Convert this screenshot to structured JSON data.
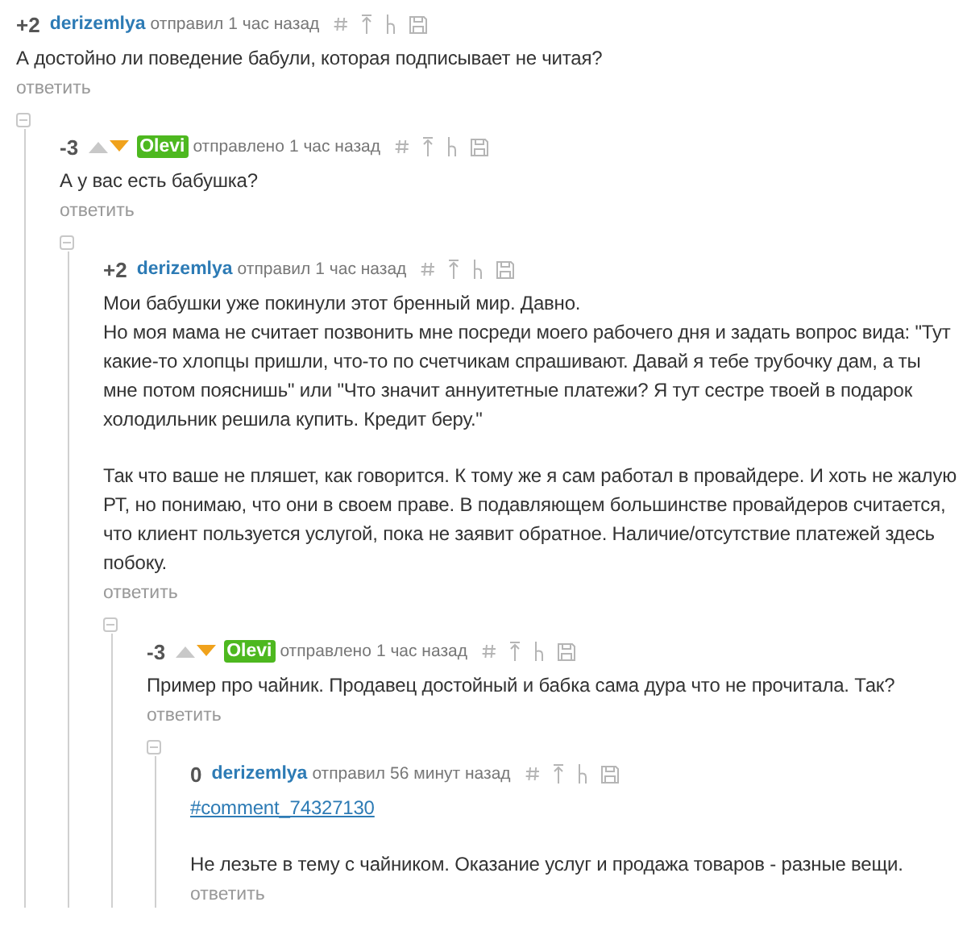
{
  "comments": [
    {
      "rating": "+2",
      "author": "derizemlya",
      "author_highlighted": false,
      "verb": "отправил",
      "time": "1 час назад",
      "body": [
        {
          "kind": "text",
          "text": "А достойно ли поведение бабули, которая подписывает не читая?"
        }
      ],
      "reply": "ответить",
      "expanded": true,
      "children": [
        {
          "rating": "-3",
          "vote": {
            "up_selected": false,
            "down_selected": true
          },
          "author": "Olevi",
          "author_highlighted": true,
          "verb": "отправлено",
          "time": "1 час назад",
          "body": [
            {
              "kind": "text",
              "text": "А у вас есть бабушка?"
            }
          ],
          "reply": "ответить",
          "expanded": true,
          "children": [
            {
              "rating": "+2",
              "author": "derizemlya",
              "author_highlighted": false,
              "verb": "отправил",
              "time": "1 час назад",
              "body": [
                {
                  "kind": "text",
                  "text": "Мои бабушки уже покинули этот бренный мир. Давно."
                },
                {
                  "kind": "text",
                  "text": "Но моя мама не считает позвонить мне посреди моего рабочего дня и задать вопрос вида: \"Тут какие-то хлопцы пришли, что-то по счетчикам спрашивают. Давай я тебе трубочку дам, а ты мне потом пояснишь\" или \"Что значит аннуитетные платежи? Я тут сестре твоей в подарок холодильник решила купить. Кредит беру.\""
                },
                {
                  "kind": "break"
                },
                {
                  "kind": "text",
                  "text": "Так что ваше не пляшет, как говорится. К тому же я сам работал в провайдере. И хоть не жалую РТ, но понимаю, что они в своем праве. В подавляющем большинстве провайдеров считается, что клиент пользуется услугой, пока не заявит обратное. Наличие/отсутствие платежей здесь побоку."
                }
              ],
              "reply": "ответить",
              "expanded": true,
              "children": [
                {
                  "rating": "-3",
                  "vote": {
                    "up_selected": false,
                    "down_selected": true
                  },
                  "author": "Olevi",
                  "author_highlighted": true,
                  "verb": "отправлено",
                  "time": "1 час назад",
                  "body": [
                    {
                      "kind": "text",
                      "text": "Пример про чайник. Продавец достойный и бабка сама дура что не прочитала. Так?"
                    }
                  ],
                  "reply": "ответить",
                  "expanded": true,
                  "children": [
                    {
                      "rating": "0",
                      "author": "derizemlya",
                      "author_highlighted": false,
                      "verb": "отправил",
                      "time": "56 минут назад",
                      "body": [
                        {
                          "kind": "link",
                          "text": "#comment_74327130"
                        },
                        {
                          "kind": "break"
                        },
                        {
                          "kind": "text",
                          "text": "Не лезьте в тему с чайником. Оказание услуг и продажа товаров - разные вещи."
                        }
                      ],
                      "reply": "ответить"
                    }
                  ]
                }
              ]
            }
          ]
        }
      ]
    }
  ]
}
